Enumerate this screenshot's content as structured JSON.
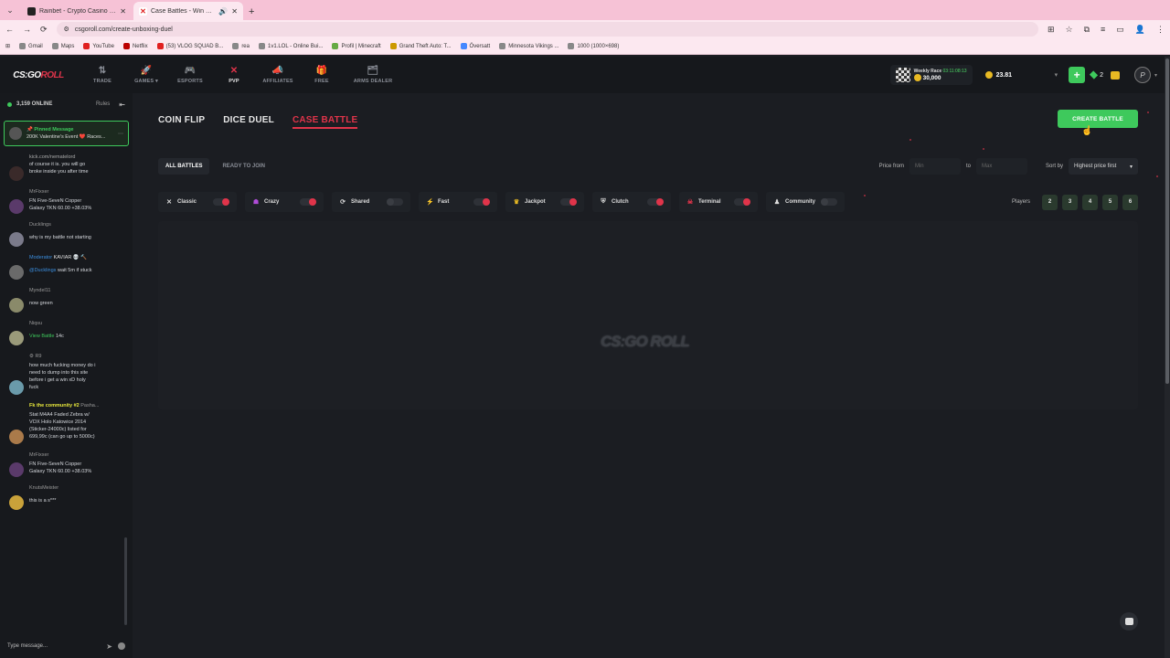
{
  "browser": {
    "tabs": [
      {
        "title": "Rainbet - Crypto Casino & Spo",
        "active": false
      },
      {
        "title": "Case Battles - Win Counter",
        "active": true
      }
    ],
    "url": "csgoroll.com/create-unboxing-duel",
    "bookmarks": [
      "Gmail",
      "Maps",
      "YouTube",
      "Netflix",
      "(53) VLOG SQUAD B...",
      "rea",
      "1v1.LOL - Online Bui...",
      "Profil | Minecraft",
      "Grand Theft Auto: T...",
      "Översatt",
      "Minnesota Vikings ...",
      "1000 (1000×698)"
    ]
  },
  "header": {
    "logo_left": "CS:GO",
    "logo_right": "ROLL",
    "nav": [
      {
        "label": "TRADE",
        "icon": "⇅"
      },
      {
        "label": "GAMES ▾",
        "icon": "🚀"
      },
      {
        "label": "ESPORTS",
        "icon": "🎮"
      },
      {
        "label": "PVP",
        "icon": "✕"
      },
      {
        "label": "AFFILIATES",
        "icon": "📣"
      },
      {
        "label": "FREE",
        "icon": "🎁"
      },
      {
        "label": "ARMS DEALER",
        "icon": "🗂"
      }
    ],
    "race_title": "Weekly Race",
    "race_timer": "03:11:08:13",
    "race_amount": "30,000",
    "balance": "23.81",
    "gems": "2"
  },
  "chat": {
    "online": "3,159 ONLINE",
    "rules": "Rules",
    "pinned_label": "Pinned Message",
    "pinned_text": "200K Valentine's Event ❤️ Races...",
    "input_placeholder": "Type message...",
    "messages": [
      {
        "user": "",
        "lines": [
          "kick.com/nematelord",
          "of course it is. you will go",
          "broke inside you after time"
        ]
      },
      {
        "user": "MrFixxer",
        "lines": [
          "FN Five-SeveN Copper",
          "Galaxy TKN 60.00 +38.03%"
        ]
      },
      {
        "user": "Ducklings",
        "lines": [
          "why is my battle not starting"
        ]
      },
      {
        "user": "Moderator",
        "user2": "KAVIAR 💀 🔨",
        "mention": "@Ducklings",
        "lines": [
          "wait 5m if stuck"
        ]
      },
      {
        "user": "Myndel11",
        "lines": [
          "now green"
        ]
      },
      {
        "user": "Niqsu",
        "link": "View Battle",
        "lines": [
          "14c"
        ]
      },
      {
        "user": "⚙ R9",
        "lines": [
          "how much fucking money do i",
          "need to dump into this site",
          "before i get a win xD holy",
          "fuck"
        ]
      },
      {
        "user": "Fk the community #2",
        "user2": "Pasha...",
        "lines": [
          "Stat M4A4 Faded Zebra w/",
          "VOX Holo Katowice 2014",
          "(Sticker-24000c) listed for",
          "699,99c (can go up to 5000c)"
        ]
      },
      {
        "user": "MrFixxer",
        "lines": [
          "FN Five-SeveN Copper",
          "Galaxy TKN 60.00 +38.03%"
        ]
      },
      {
        "user": "KnutsMeister",
        "lines": [
          "this is a s***"
        ]
      }
    ]
  },
  "main": {
    "game_tabs": [
      "COIN FLIP",
      "DICE DUEL",
      "CASE BATTLE"
    ],
    "active_game_tab": "CASE BATTLE",
    "create_button": "CREATE BATTLE",
    "filter_tabs": [
      "ALL BATTLES",
      "READY TO JOIN"
    ],
    "price_from_label": "Price from",
    "min_placeholder": "Min",
    "to_label": "to",
    "max_placeholder": "Max",
    "sort_label": "Sort by",
    "sort_value": "Highest price first",
    "modes": [
      {
        "label": "Classic",
        "icon": "✕",
        "on": true
      },
      {
        "label": "Crazy",
        "icon": "☗",
        "on": true
      },
      {
        "label": "Shared",
        "icon": "⟳",
        "on": false
      },
      {
        "label": "Fast",
        "icon": "⚡",
        "on": true
      },
      {
        "label": "Jackpot",
        "icon": "♛",
        "on": true
      },
      {
        "label": "Clutch",
        "icon": "⛨",
        "on": true
      },
      {
        "label": "Terminal",
        "icon": "☠",
        "on": true
      },
      {
        "label": "Community",
        "icon": "♟",
        "on": false
      }
    ],
    "players_label": "Players",
    "player_counts": [
      "2",
      "3",
      "4",
      "5",
      "6"
    ],
    "watermark": "CS:GO ROLL"
  }
}
